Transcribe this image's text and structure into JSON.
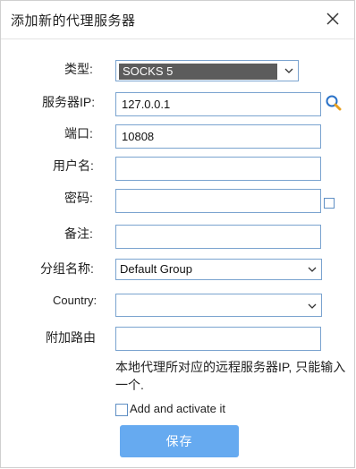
{
  "window": {
    "title": "添加新的代理服务器",
    "close_icon": "close-icon"
  },
  "form": {
    "type_label": "类型:",
    "type_value": "SOCKS 5",
    "server_ip_label": "服务器IP:",
    "server_ip_value": "127.0.0.1",
    "search_icon": "search-icon",
    "port_label": "端口:",
    "port_value": "10808",
    "username_label": "用户名:",
    "username_value": "",
    "password_label": "密码:",
    "password_value": "",
    "note_label": "备注:",
    "note_value": "",
    "group_label": "分组名称:",
    "group_value": "Default Group",
    "country_label": "Country:",
    "country_value": "",
    "route_label": "附加路由",
    "route_value": "",
    "hint": "本地代理所对应的远程服务器IP, 只能输入一个.",
    "activate_label": "Add and activate it",
    "activate_checked": false,
    "password_show_checked": false
  },
  "buttons": {
    "save": "保存"
  },
  "colors": {
    "accent": "#66aaf0",
    "field_border": "#7aa3cf",
    "type_highlight": "#5c5c5c"
  }
}
